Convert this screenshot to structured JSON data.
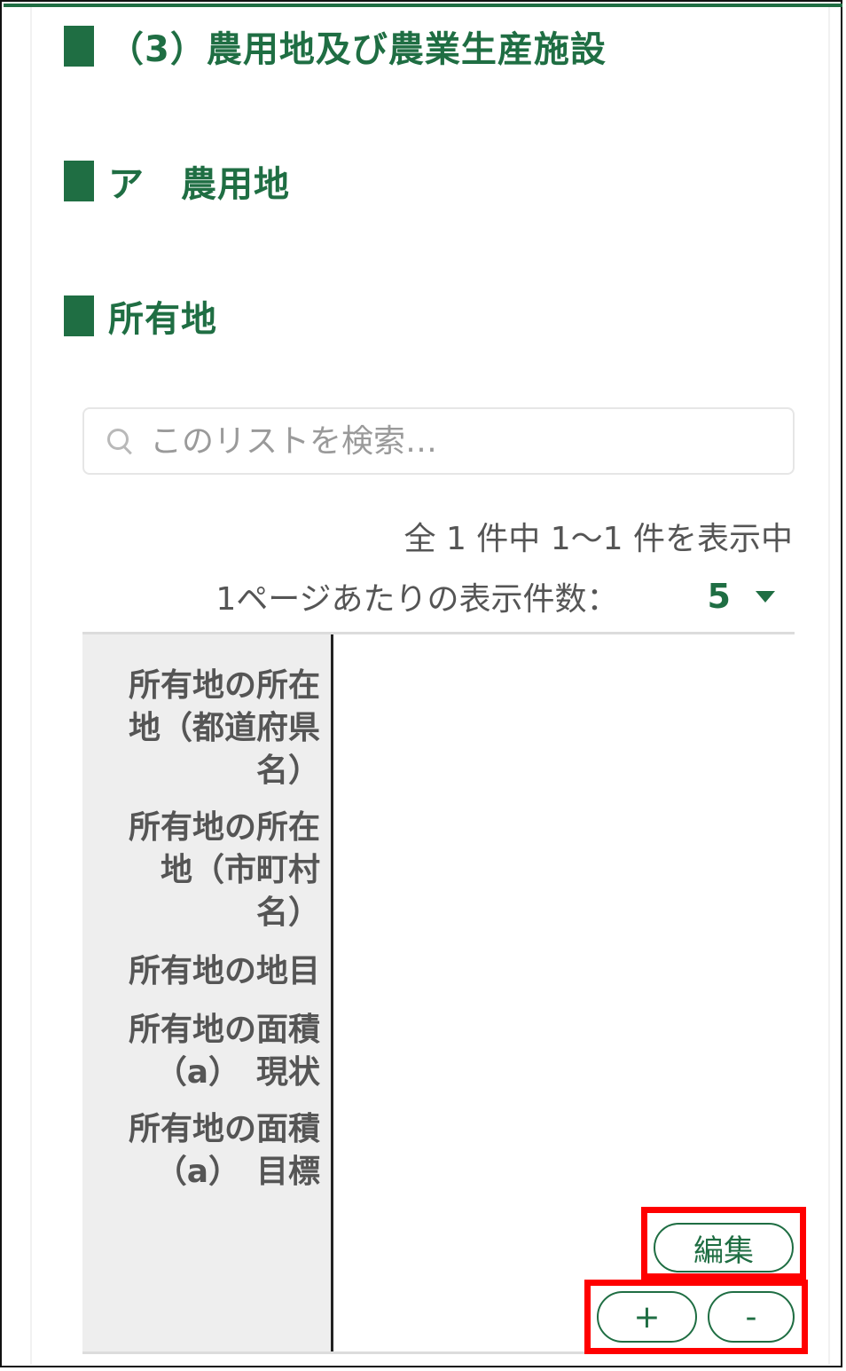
{
  "headings": {
    "section": "（3）農用地及び農業生産施設",
    "subsection": "ア　農用地",
    "table_title": "所有地"
  },
  "search": {
    "placeholder": "このリストを検索…",
    "icon": "search-icon"
  },
  "pagination": {
    "count_text": "全 1 件中 1～1 件を表示中",
    "per_page_label": "1ページあたりの表示件数：",
    "per_page_value": "5"
  },
  "table": {
    "row_labels": [
      "所有地の所在\n地（都道府県\n名）",
      "所有地の所在\n地（市町村\n名）",
      "所有地の地目",
      "所有地の面積\n（a）　現状",
      "所有地の面積\n（a）　目標"
    ]
  },
  "buttons": {
    "edit": "編集",
    "add": "+",
    "remove": "-"
  },
  "colors": {
    "accent": "#1f6e43",
    "highlight": "#ff0000",
    "label_bg": "#eeeeee"
  }
}
